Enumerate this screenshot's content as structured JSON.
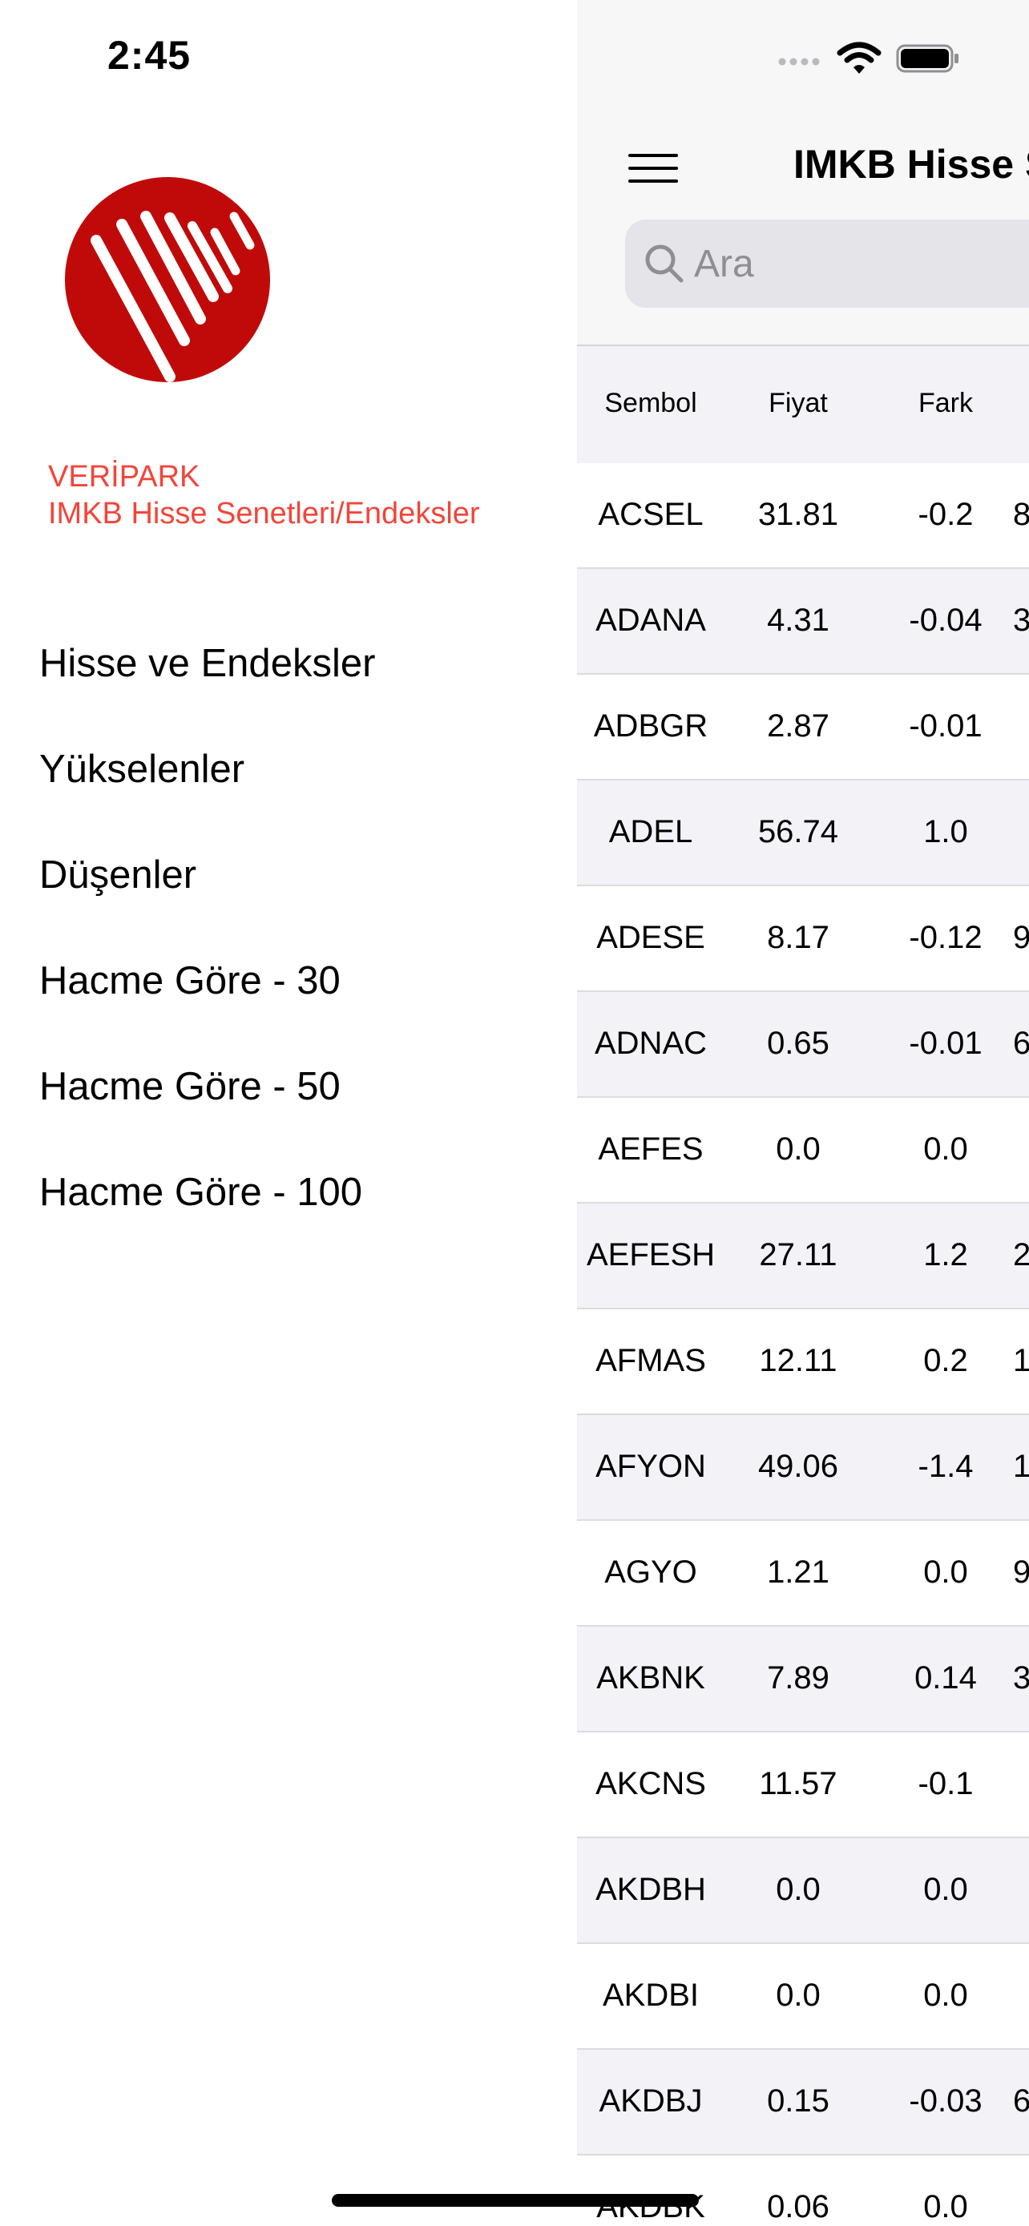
{
  "status_bar": {
    "time": "2:45"
  },
  "brand": {
    "name": "VERİPARK",
    "subtitle": "IMKB Hisse Senetleri/Endeksler",
    "accent_color": "#f2453a",
    "logo_color": "#c00a0a"
  },
  "menu": {
    "items": [
      {
        "label": "Hisse ve Endeksler"
      },
      {
        "label": "Yükselenler"
      },
      {
        "label": "Düşenler"
      },
      {
        "label": "Hacme Göre - 30"
      },
      {
        "label": "Hacme Göre - 50"
      },
      {
        "label": "Hacme Göre - 100"
      }
    ]
  },
  "nav": {
    "title": "IMKB Hisse S"
  },
  "search": {
    "placeholder": "Ara"
  },
  "table": {
    "columns": [
      "Sembol",
      "Fiyat",
      "Fark"
    ],
    "rows": [
      {
        "symbol": "ACSEL",
        "price": "31.81",
        "diff": "-0.2",
        "extra": "8"
      },
      {
        "symbol": "ADANA",
        "price": "4.31",
        "diff": "-0.04",
        "extra": "3"
      },
      {
        "symbol": "ADBGR",
        "price": "2.87",
        "diff": "-0.01",
        "extra": ""
      },
      {
        "symbol": "ADEL",
        "price": "56.74",
        "diff": "1.0",
        "extra": ""
      },
      {
        "symbol": "ADESE",
        "price": "8.17",
        "diff": "-0.12",
        "extra": "9"
      },
      {
        "symbol": "ADNAC",
        "price": "0.65",
        "diff": "-0.01",
        "extra": "6"
      },
      {
        "symbol": "AEFES",
        "price": "0.0",
        "diff": "0.0",
        "extra": ""
      },
      {
        "symbol": "AEFESH",
        "price": "27.11",
        "diff": "1.2",
        "extra": "2"
      },
      {
        "symbol": "AFMAS",
        "price": "12.11",
        "diff": "0.2",
        "extra": "1"
      },
      {
        "symbol": "AFYON",
        "price": "49.06",
        "diff": "-1.4",
        "extra": "1"
      },
      {
        "symbol": "AGYO",
        "price": "1.21",
        "diff": "0.0",
        "extra": "9"
      },
      {
        "symbol": "AKBNK",
        "price": "7.89",
        "diff": "0.14",
        "extra": "3"
      },
      {
        "symbol": "AKCNS",
        "price": "11.57",
        "diff": "-0.1",
        "extra": ""
      },
      {
        "symbol": "AKDBH",
        "price": "0.0",
        "diff": "0.0",
        "extra": ""
      },
      {
        "symbol": "AKDBI",
        "price": "0.0",
        "diff": "0.0",
        "extra": ""
      },
      {
        "symbol": "AKDBJ",
        "price": "0.15",
        "diff": "-0.03",
        "extra": "6"
      },
      {
        "symbol": "AKDBK",
        "price": "0.06",
        "diff": "0.0",
        "extra": ""
      }
    ]
  }
}
